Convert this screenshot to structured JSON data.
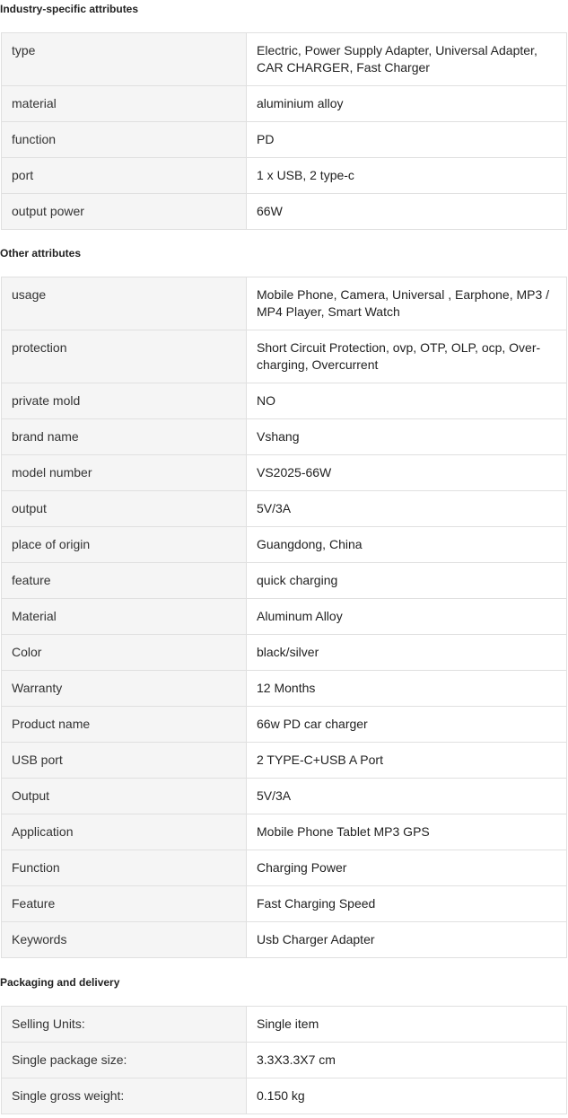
{
  "sections": [
    {
      "title": "Industry-specific attributes",
      "rows": [
        {
          "key": "type",
          "value": "Electric, Power Supply Adapter, Universal Adapter, CAR CHARGER, Fast Charger"
        },
        {
          "key": "material",
          "value": "aluminium alloy"
        },
        {
          "key": "function",
          "value": "PD"
        },
        {
          "key": "port",
          "value": "1 x USB, 2 type-c"
        },
        {
          "key": "output power",
          "value": "66W"
        }
      ]
    },
    {
      "title": "Other attributes",
      "rows": [
        {
          "key": "usage",
          "value": "Mobile Phone, Camera, Universal , Earphone, MP3 / MP4 Player, Smart Watch"
        },
        {
          "key": "protection",
          "value": "Short Circuit Protection, ovp, OTP, OLP, ocp, Over-charging, Overcurrent"
        },
        {
          "key": "private mold",
          "value": "NO"
        },
        {
          "key": "brand name",
          "value": "Vshang"
        },
        {
          "key": "model number",
          "value": "VS2025-66W"
        },
        {
          "key": "output",
          "value": "5V/3A"
        },
        {
          "key": "place of origin",
          "value": "Guangdong, China"
        },
        {
          "key": "feature",
          "value": "quick charging"
        },
        {
          "key": "Material",
          "value": "Aluminum Alloy"
        },
        {
          "key": "Color",
          "value": "black/silver"
        },
        {
          "key": "Warranty",
          "value": "12 Months"
        },
        {
          "key": "Product name",
          "value": "66w PD car charger"
        },
        {
          "key": "USB port",
          "value": "2 TYPE-C+USB A Port"
        },
        {
          "key": "Output",
          "value": "5V/3A"
        },
        {
          "key": "Application",
          "value": "Mobile Phone Tablet MP3 GPS"
        },
        {
          "key": "Function",
          "value": "Charging Power"
        },
        {
          "key": "Feature",
          "value": "Fast Charging Speed"
        },
        {
          "key": "Keywords",
          "value": "Usb Charger Adapter"
        }
      ]
    },
    {
      "title": "Packaging and delivery",
      "rows": [
        {
          "key": "Selling Units:",
          "value": "Single item"
        },
        {
          "key": "Single package size:",
          "value": "3.3X3.3X7 cm"
        },
        {
          "key": "Single gross weight:",
          "value": "0.150 kg"
        }
      ]
    }
  ]
}
